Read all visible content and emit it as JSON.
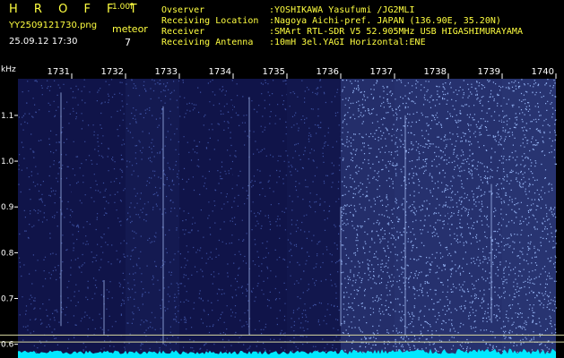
{
  "header": {
    "brand": "H R O F F T",
    "version": "1.00f",
    "filename": "YY2509121730.png",
    "datetime": "25.09.12 17:30",
    "meteor_label": "meteor",
    "meteor_count": "7"
  },
  "station": [
    {
      "key": "Ovserver",
      "value": ":YOSHIKAWA Yasufumi /JG2MLI"
    },
    {
      "key": "Receiving Location",
      "value": ":Nagoya Aichi-pref. JAPAN (136.90E, 35.20N)"
    },
    {
      "key": "Receiver",
      "value": ":SMArt RTL-SDR V5 52.905MHz USB HIGASHIMURAYAMA"
    },
    {
      "key": "Receiving Antenna",
      "value": ":10mH 3el.YAGI Horizontal:ENE"
    }
  ],
  "colors": {
    "background": "#000000",
    "header_text": "#ffff40",
    "noise_dark": "#000030",
    "noise_bright": "#7fa6ff",
    "baseline": "#00e8ff",
    "marker_line": "#d8d8a0"
  },
  "chart_data": {
    "type": "heatmap",
    "ylabel": "kHz",
    "x_ticks": [
      "1731",
      "1732",
      "1733",
      "1734",
      "1735",
      "1736",
      "1737",
      "1738",
      "1739",
      "1740"
    ],
    "y_ticks": [
      "1.1",
      "1.0",
      "0.9",
      "0.8",
      "0.7",
      "0.6"
    ],
    "ylim": [
      0.57,
      1.18
    ],
    "marker_lines_khz": [
      0.62,
      0.605
    ],
    "xlim": [
      "17:30",
      "17:40"
    ],
    "grid": false,
    "noise_level_by_minute": [
      0.35,
      0.35,
      0.45,
      0.35,
      0.35,
      0.4,
      0.8,
      0.85,
      0.85,
      0.9
    ],
    "meteor_echoes": [
      {
        "time": "17:30.8",
        "khz_low": 0.64,
        "khz_high": 1.15
      },
      {
        "time": "17:31.6",
        "khz_low": 0.62,
        "khz_high": 0.74
      },
      {
        "time": "17:32.7",
        "khz_low": 0.6,
        "khz_high": 1.12
      },
      {
        "time": "17:34.3",
        "khz_low": 0.62,
        "khz_high": 1.14
      },
      {
        "time": "17:36.0",
        "khz_low": 0.64,
        "khz_high": 0.9
      },
      {
        "time": "17:37.2",
        "khz_low": 0.62,
        "khz_high": 1.1
      },
      {
        "time": "17:38.8",
        "khz_low": 0.65,
        "khz_high": 0.95
      }
    ]
  }
}
